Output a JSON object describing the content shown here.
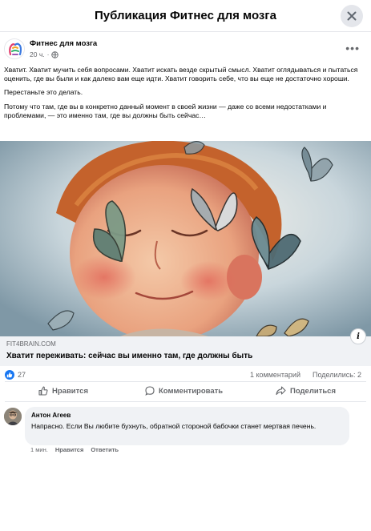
{
  "header": {
    "title": "Публикация Фитнес для мозга"
  },
  "author": {
    "name": "Фитнес для мозга",
    "time": "20 ч."
  },
  "post": {
    "paragraphs": [
      "Хватит. Хватит мучить себя вопросами. Хватит искать везде скрытый смысл. Хватит оглядываться и пытаться оценить, где вы были и как далеко вам еще идти. Хватит говорить себе, что вы еще не достаточно хороши.",
      "Перестаньте это делать.",
      "Потому что там, где вы в конкретно данный момент в своей жизни — даже со всеми недостатками и проблемами, — это именно там, где вы должны быть сейчас…"
    ]
  },
  "link": {
    "domain": "FIT4BRAIN.COM",
    "title": "Хватит переживать: сейчас вы именно там, где должны быть"
  },
  "stats": {
    "likes": "27",
    "comments": "1 комментарий",
    "shares": "Поделились: 2"
  },
  "actions": {
    "like": "Нравится",
    "comment": "Комментировать",
    "share": "Поделиться"
  },
  "comment": {
    "author": "Антон Агеев",
    "text": "Напрасно. Если Вы любите бухнуть, обратной стороной бабочки станет мертвая печень.",
    "time": "1 мин.",
    "like": "Нравится",
    "reply": "Ответить"
  },
  "colors": {
    "accent": "#1877f2",
    "secondary_text": "#65676b",
    "bubble": "#f0f2f5"
  }
}
